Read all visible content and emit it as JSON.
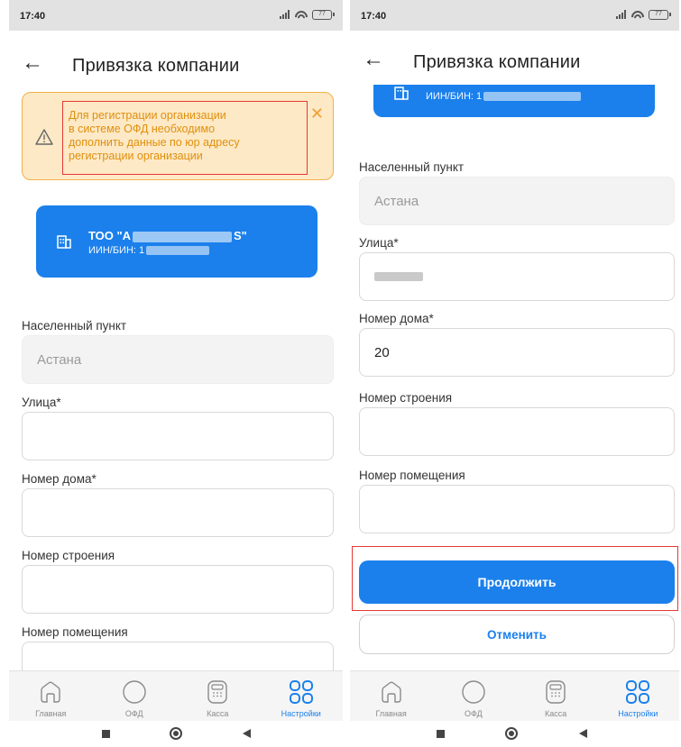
{
  "status_bar": {
    "time": "17:40",
    "battery": "77"
  },
  "app_bar": {
    "title": "Привязка компании"
  },
  "alert": {
    "lines": [
      "Для регистрации организации",
      "в системе ОФД необходимо",
      "дополнить данные по юр адресу",
      "регистрации организации"
    ]
  },
  "company": {
    "name": "ТОО \"А",
    "name_end": "S\"",
    "bin_label": "ИИН/БИН: 1"
  },
  "fields": {
    "city": {
      "label": "Населенный пункт",
      "value": "Астана"
    },
    "street": {
      "label": "Улица*"
    },
    "house": {
      "label": "Номер дома*",
      "value_right": "20"
    },
    "building": {
      "label": "Номер строения"
    },
    "room": {
      "label": "Номер помещения"
    }
  },
  "buttons": {
    "continue": "Продолжить",
    "cancel": "Отменить"
  },
  "bottom_nav": [
    {
      "label": "Главная",
      "icon": "home-icon",
      "active": false
    },
    {
      "label": "ОФД",
      "icon": "circle-icon",
      "active": false
    },
    {
      "label": "Касса",
      "icon": "cash-register-icon",
      "active": false
    },
    {
      "label": "Настройки",
      "icon": "grid-icon",
      "active": true
    }
  ],
  "colors": {
    "primary": "#1b80ec",
    "alert_bg": "#fde9c6",
    "alert_text": "#e0900d",
    "highlight": "#e53935"
  }
}
